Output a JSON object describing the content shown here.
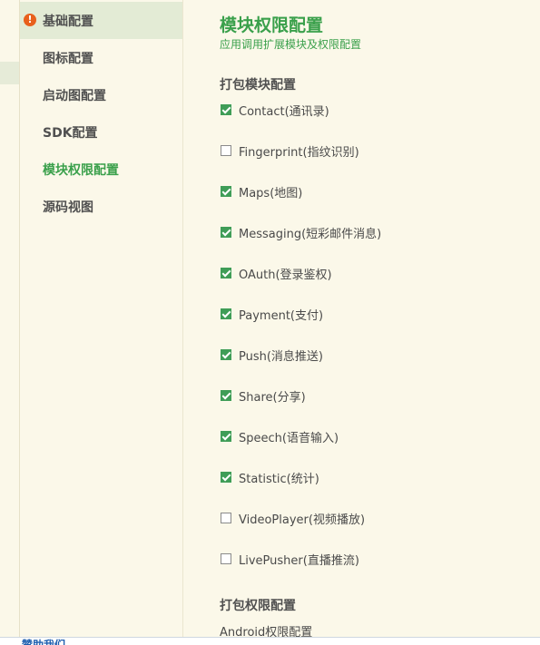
{
  "sidebar": {
    "items": [
      {
        "label": "基础配置",
        "warning": true
      },
      {
        "label": "图标配置"
      },
      {
        "label": "启动图配置"
      },
      {
        "label": "SDK配置"
      },
      {
        "label": "模块权限配置",
        "active": true
      },
      {
        "label": "源码视图"
      }
    ]
  },
  "main": {
    "title": "模块权限配置",
    "subtitle": "应用调用扩展模块及权限配置",
    "packaging_modules": {
      "title": "打包模块配置",
      "modules": [
        {
          "label": "Contact(通讯录)",
          "checked": true
        },
        {
          "label": "Fingerprint(指纹识别)",
          "checked": false
        },
        {
          "label": "Maps(地图)",
          "checked": true
        },
        {
          "label": "Messaging(短彩邮件消息)",
          "checked": true
        },
        {
          "label": "OAuth(登录鉴权)",
          "checked": true
        },
        {
          "label": "Payment(支付)",
          "checked": true
        },
        {
          "label": "Push(消息推送)",
          "checked": true
        },
        {
          "label": "Share(分享)",
          "checked": true
        },
        {
          "label": "Speech(语音输入)",
          "checked": true
        },
        {
          "label": "Statistic(统计)",
          "checked": true
        },
        {
          "label": "VideoPlayer(视频播放)",
          "checked": false
        },
        {
          "label": "LivePusher(直播推流)",
          "checked": false
        }
      ]
    },
    "packaging_permissions": {
      "title": "打包权限配置",
      "android_label": "Android权限配置"
    }
  },
  "footer": {
    "link": "赞助我们"
  },
  "colors": {
    "accent_green": "#3aa04b",
    "checkbox_green": "#3f9d57",
    "warning_orange": "#e8601c",
    "background": "#fbf8e9",
    "link_blue": "#1f5fb0"
  }
}
